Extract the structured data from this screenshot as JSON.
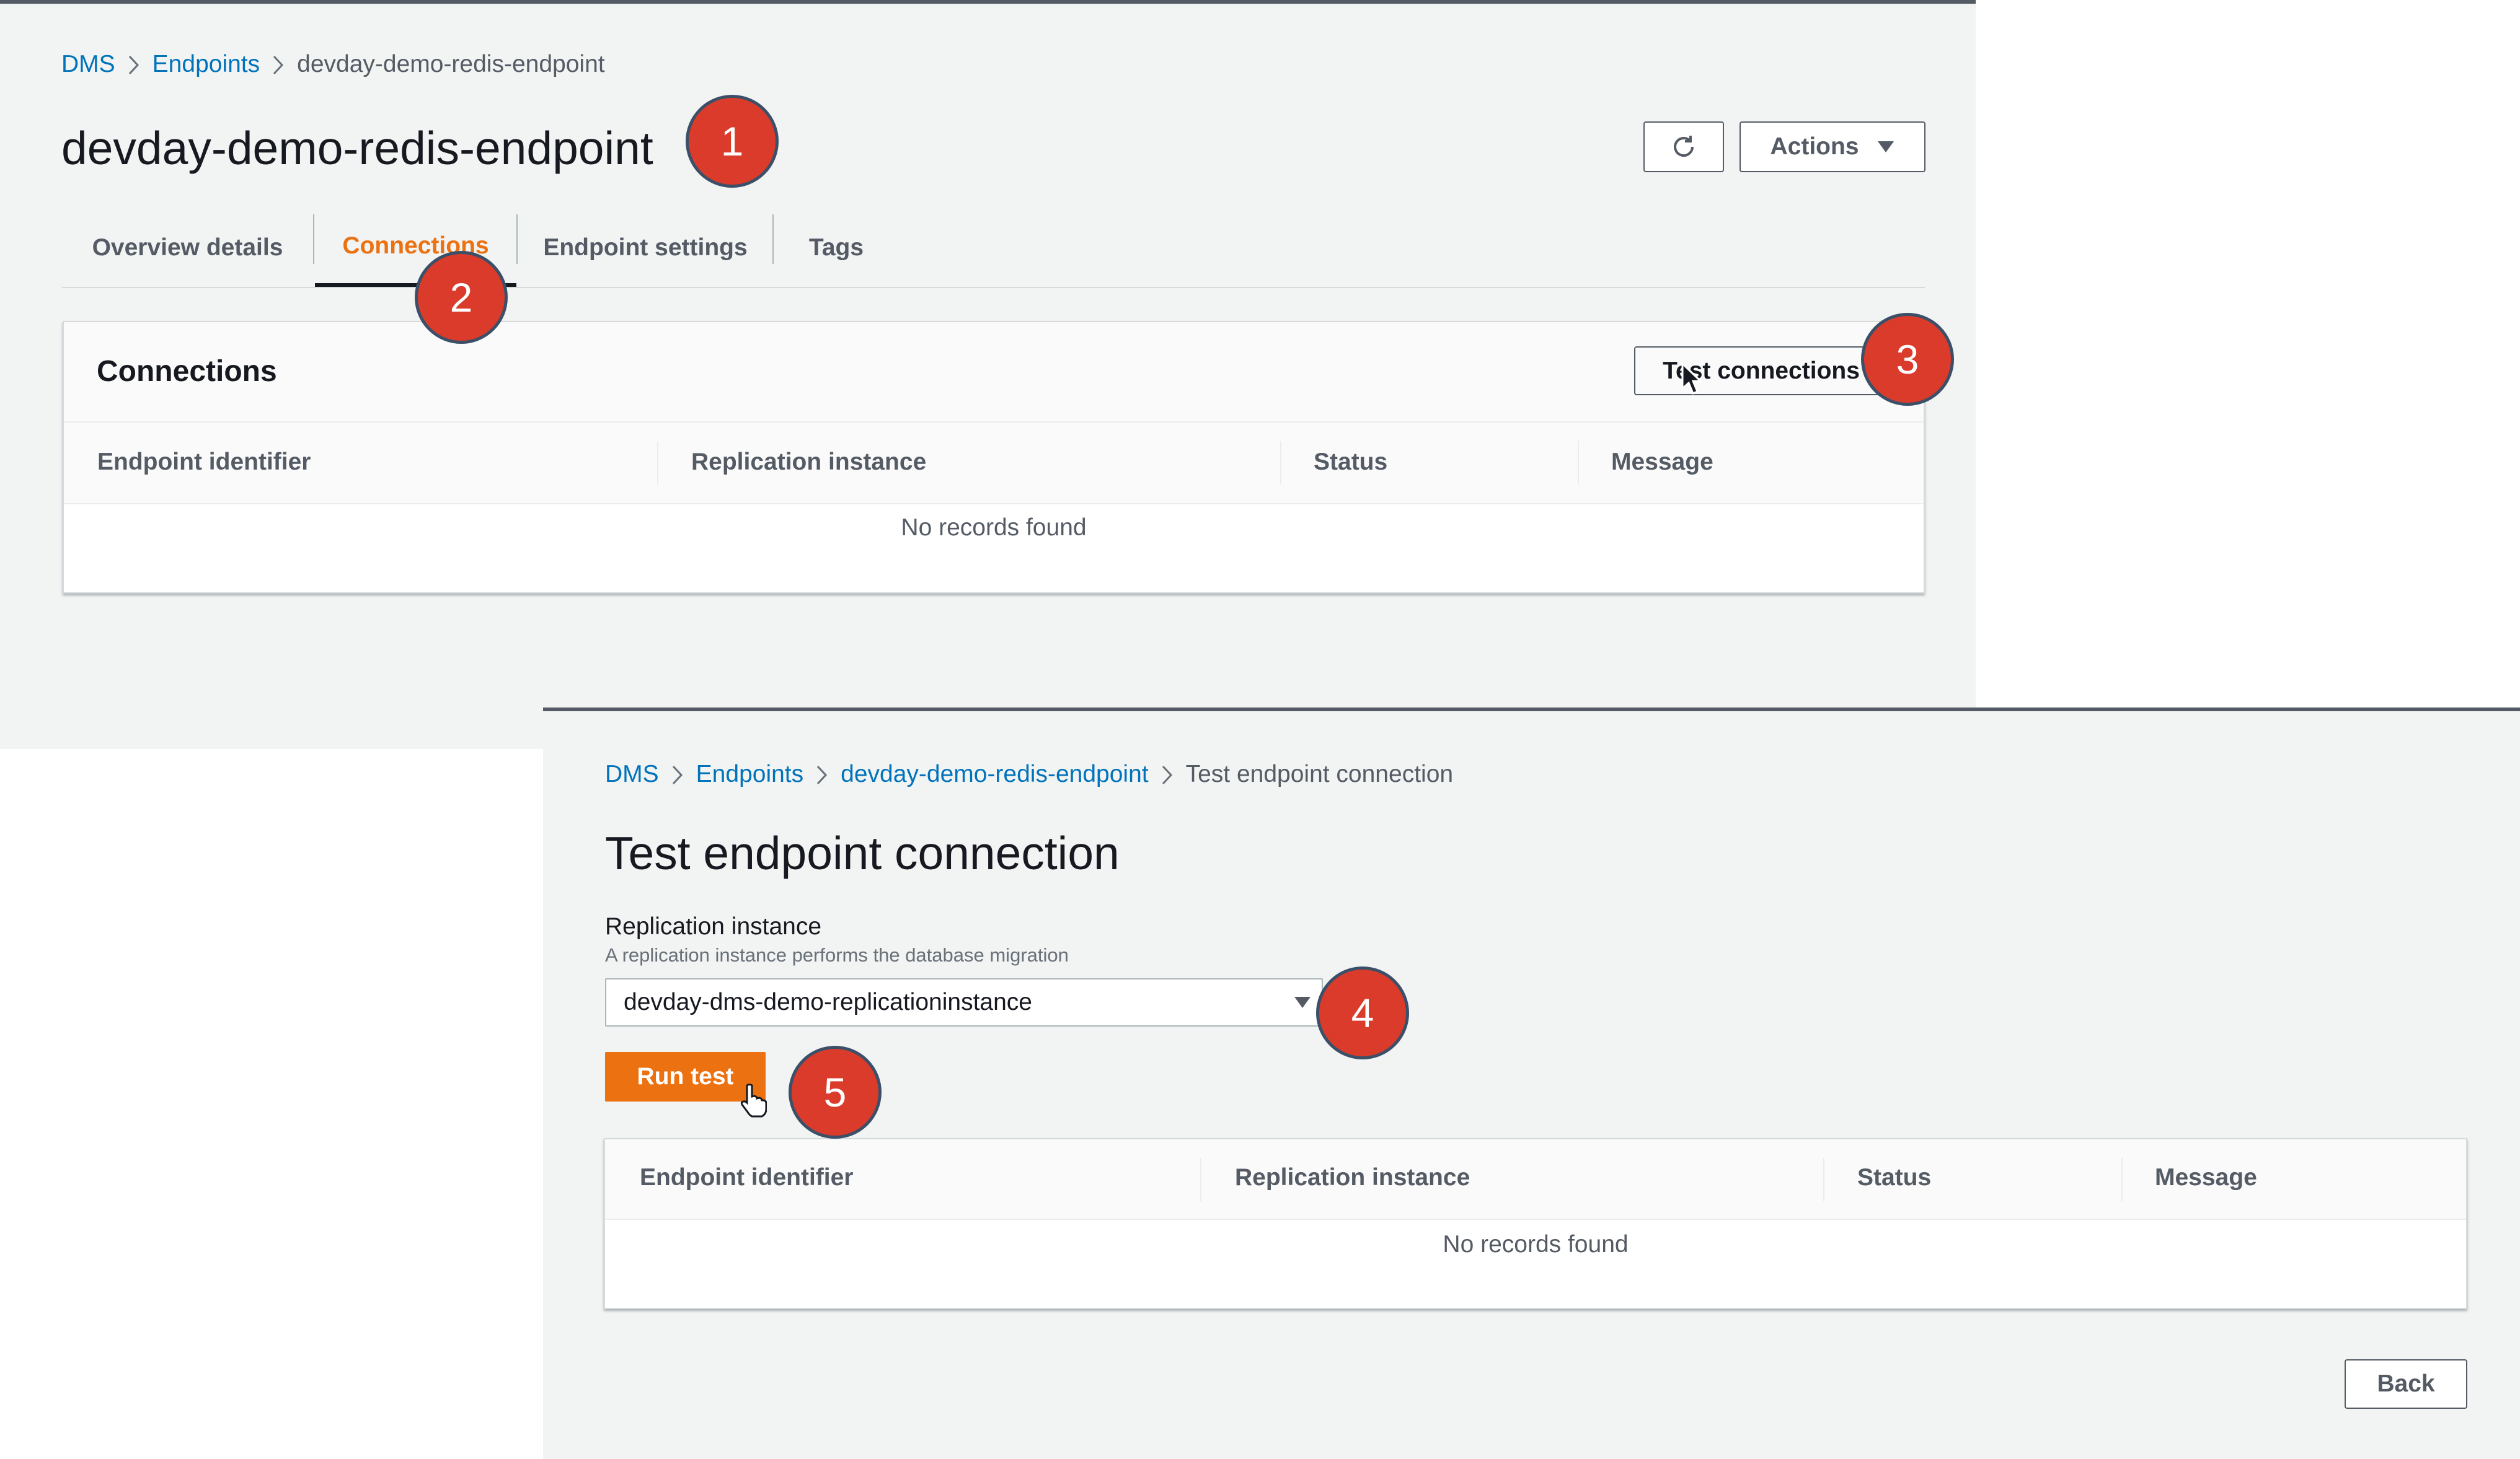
{
  "top": {
    "breadcrumb": {
      "dms": "DMS",
      "endpoints": "Endpoints",
      "current": "devday-demo-redis-endpoint"
    },
    "title": "devday-demo-redis-endpoint",
    "actions_label": "Actions",
    "tabs": [
      {
        "label": "Overview details"
      },
      {
        "label": "Connections"
      },
      {
        "label": "Endpoint settings"
      },
      {
        "label": "Tags"
      }
    ],
    "active_tab": "Connections",
    "connections": {
      "heading": "Connections",
      "test_button": "Test connections",
      "columns": [
        "Endpoint identifier",
        "Replication instance",
        "Status",
        "Message"
      ],
      "empty": "No records found"
    }
  },
  "bottom": {
    "breadcrumb": {
      "dms": "DMS",
      "endpoints": "Endpoints",
      "endpoint": "devday-demo-redis-endpoint",
      "current": "Test endpoint connection"
    },
    "title": "Test endpoint connection",
    "field_label": "Replication instance",
    "field_desc": "A replication instance performs the database migration",
    "selected_instance": "devday-dms-demo-replicationinstance",
    "run_button": "Run test",
    "columns": [
      "Endpoint identifier",
      "Replication instance",
      "Status",
      "Message"
    ],
    "empty": "No records found",
    "back_button": "Back"
  },
  "steps": [
    "1",
    "2",
    "3",
    "4",
    "5"
  ],
  "colors": {
    "accent": "#ec7211",
    "link": "#0073bb",
    "badge": "#da3b2b"
  },
  "icons": [
    "refresh-icon",
    "caret-down-icon",
    "chevron-right-icon",
    "pointer-cursor-icon",
    "hand-cursor-icon"
  ]
}
